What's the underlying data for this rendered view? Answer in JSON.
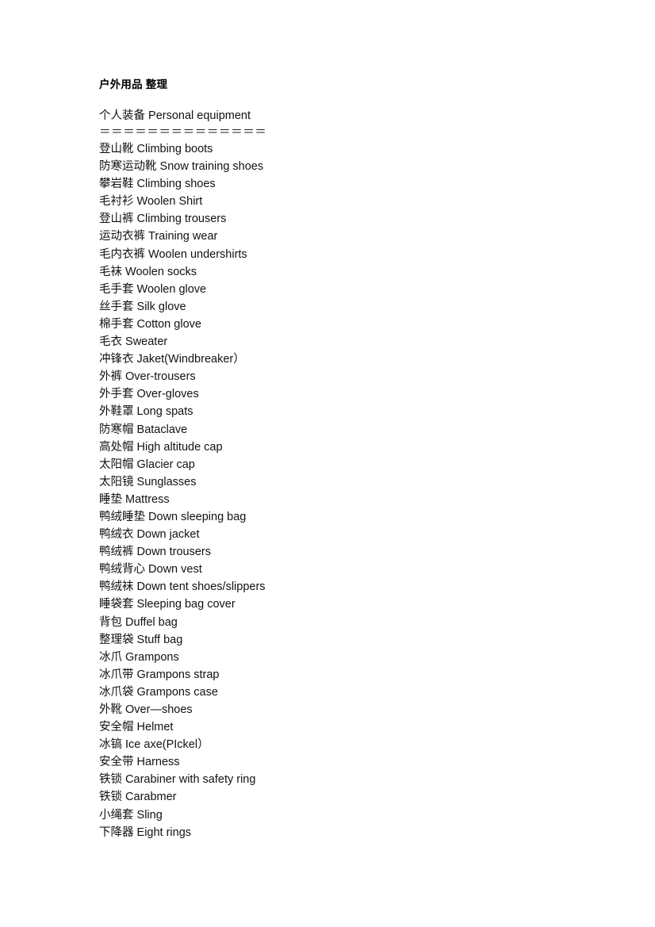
{
  "document": {
    "title": "户外用品 整理",
    "section_header": "个人装备 Personal equipment",
    "divider": "＝＝＝＝＝＝＝＝＝＝＝＝＝＝",
    "entries": [
      "登山靴 Climbing boots",
      "防寒运动靴 Snow training shoes",
      "攀岩鞋 Climbing shoes",
      "毛衬衫 Woolen Shirt",
      "登山裤 Climbing trousers",
      "运动衣裤 Training wear",
      "毛内衣裤 Woolen undershirts",
      "毛袜 Woolen socks",
      "毛手套 Woolen glove",
      "丝手套 Silk glove",
      "棉手套 Cotton glove",
      "毛衣 Sweater",
      "冲锋衣 Jaket(Windbreaker）",
      "外裤 Over-trousers",
      "外手套 Over-gloves",
      "外鞋罩 Long spats",
      "防寒帽 Bataclave",
      "高处帽 High altitude cap",
      "太阳帽 Glacier cap",
      "太阳镜 Sunglasses",
      "睡垫 Mattress",
      "鸭绒睡垫 Down sleeping bag",
      "鸭绒衣 Down jacket",
      "鸭绒裤 Down trousers",
      "鸭绒背心 Down vest",
      "鸭绒袜 Down tent shoes/slippers",
      "睡袋套 Sleeping bag cover",
      "背包 Duffel bag",
      "整理袋 Stuff bag",
      "冰爪 Grampons",
      "冰爪带 Grampons strap",
      "冰爪袋 Grampons case",
      "外靴 Over—shoes",
      "安全帽 Helmet",
      "冰镐 Ice axe(PIckel）",
      "安全带 Harness",
      "铁锁 Carabiner with safety ring",
      "铁锁 Carabmer",
      "小绳套 Sling",
      "下降器 Eight rings"
    ]
  }
}
